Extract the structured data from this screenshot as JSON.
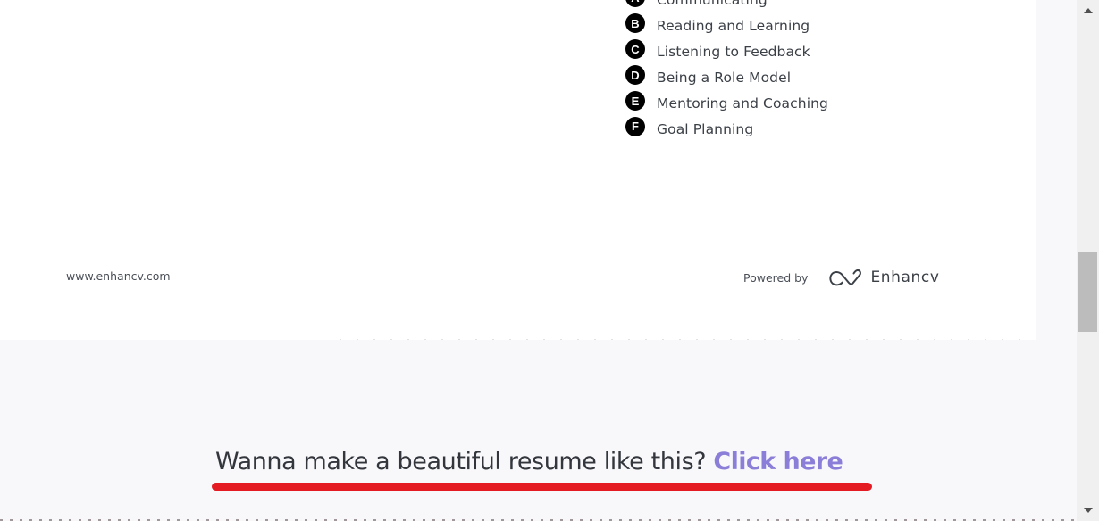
{
  "resume": {
    "skills": [
      {
        "badge": "A",
        "label": "Communicating"
      },
      {
        "badge": "B",
        "label": "Reading and Learning"
      },
      {
        "badge": "C",
        "label": "Listening to Feedback"
      },
      {
        "badge": "D",
        "label": "Being a Role Model"
      },
      {
        "badge": "E",
        "label": "Mentoring and Coaching"
      },
      {
        "badge": "F",
        "label": "Goal Planning"
      }
    ],
    "footer": {
      "url": "www.enhancv.com",
      "powered_by_label": "Powered by",
      "brand_name": "Enhancv",
      "brand_icon": "enhancv-logo-icon"
    }
  },
  "cta": {
    "question": "Wanna make a beautiful resume like this? ",
    "link_label": "Click here",
    "link_color": "#8b7ed8",
    "underline_color": "#e51b24"
  },
  "scrollbar": {
    "up_icon": "triangle-up-icon",
    "down_icon": "triangle-down-icon"
  }
}
